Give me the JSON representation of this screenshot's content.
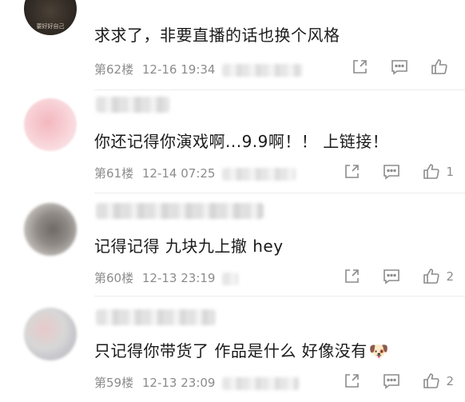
{
  "comments": [
    {
      "text": "求求了，非要直播的话也换个风格",
      "floor": "第62楼",
      "time": "12-16 19:34",
      "likes": "",
      "avatar_text": "要好好自己"
    },
    {
      "text": "你还记得你演戏啊...9.9啊！！ 上链接！",
      "floor": "第61楼",
      "time": "12-14 07:25",
      "likes": "1"
    },
    {
      "text": "记得记得 九块九上撤 hey",
      "floor": "第60楼",
      "time": "12-13 23:19",
      "likes": "2"
    },
    {
      "text": "只记得你带货了 作品是什么 好像没有",
      "emoji": "🐶",
      "floor": "第59楼",
      "time": "12-13 23:09",
      "likes": "2"
    }
  ],
  "icons": {
    "share": "share-icon",
    "comment": "comment-icon",
    "like": "thumbs-up-icon"
  },
  "colors": {
    "meta_text": "#8c8c8c",
    "divider": "#ececec"
  }
}
